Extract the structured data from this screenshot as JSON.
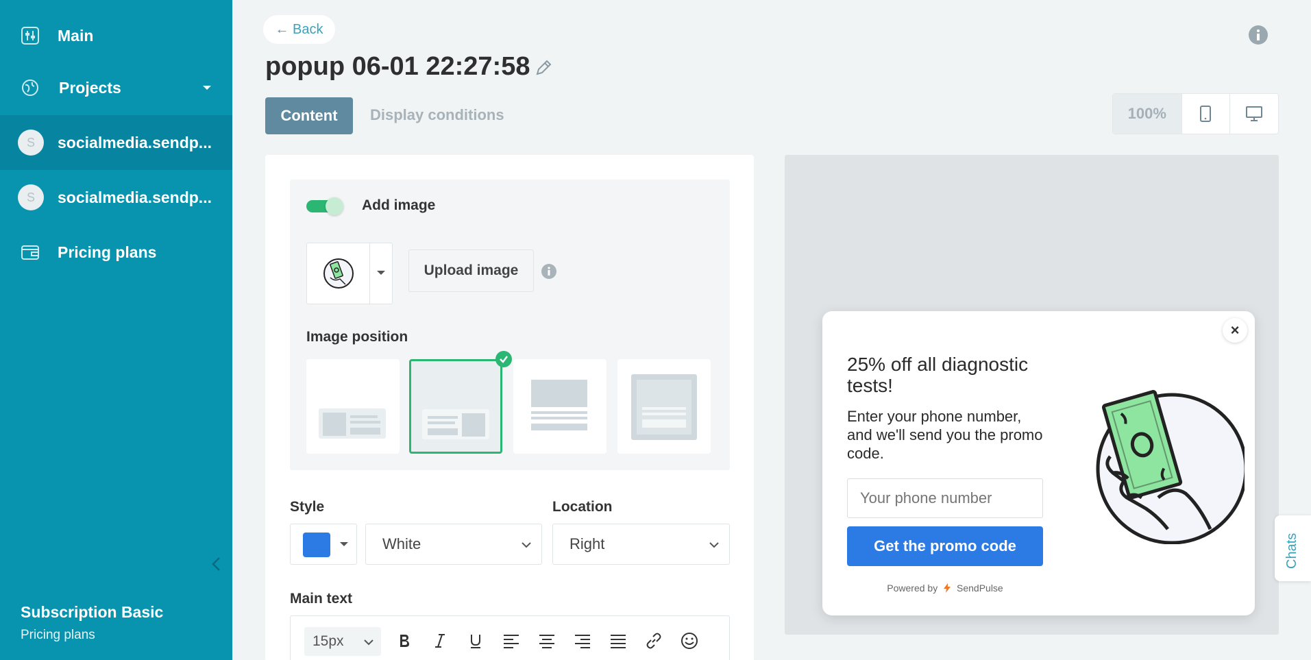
{
  "sidebar": {
    "items": [
      {
        "label": "Main",
        "icon": "sliders-icon"
      },
      {
        "label": "Projects",
        "icon": "globe-icon"
      },
      {
        "label": "socialmedia.sendp...",
        "avatar": "S"
      },
      {
        "label": "socialmedia.sendp...",
        "avatar": "S"
      },
      {
        "label": "Pricing plans",
        "icon": "wallet-icon"
      }
    ],
    "subscription_title": "Subscription Basic",
    "subscription_link": "Pricing plans"
  },
  "header": {
    "back_label": "← Back",
    "title": "popup 06-01 22:27:58",
    "tabs": [
      "Content",
      "Display conditions"
    ],
    "zoom": "100%"
  },
  "editor": {
    "add_image_label": "Add image",
    "add_image_enabled": true,
    "upload_label": "Upload image",
    "image_position_label": "Image position",
    "image_position_selected": 1,
    "style_label": "Style",
    "style_color": "#2c7be5",
    "style_value": "White",
    "location_label": "Location",
    "location_value": "Right",
    "main_text_label": "Main text",
    "font_size": "15px"
  },
  "popup": {
    "heading": "25% off all diagnostic tests!",
    "body": "Enter your phone number, and we'll send you the promo code.",
    "input_placeholder": "Your phone number",
    "button_label": "Get the promo code",
    "powered_by": "Powered by",
    "brand": "SendPulse",
    "close": "×"
  },
  "chats_label": "Chats",
  "colors": {
    "sidebar": "#0894ae",
    "accent_green": "#2bb673",
    "primary_blue": "#2c7be5"
  }
}
